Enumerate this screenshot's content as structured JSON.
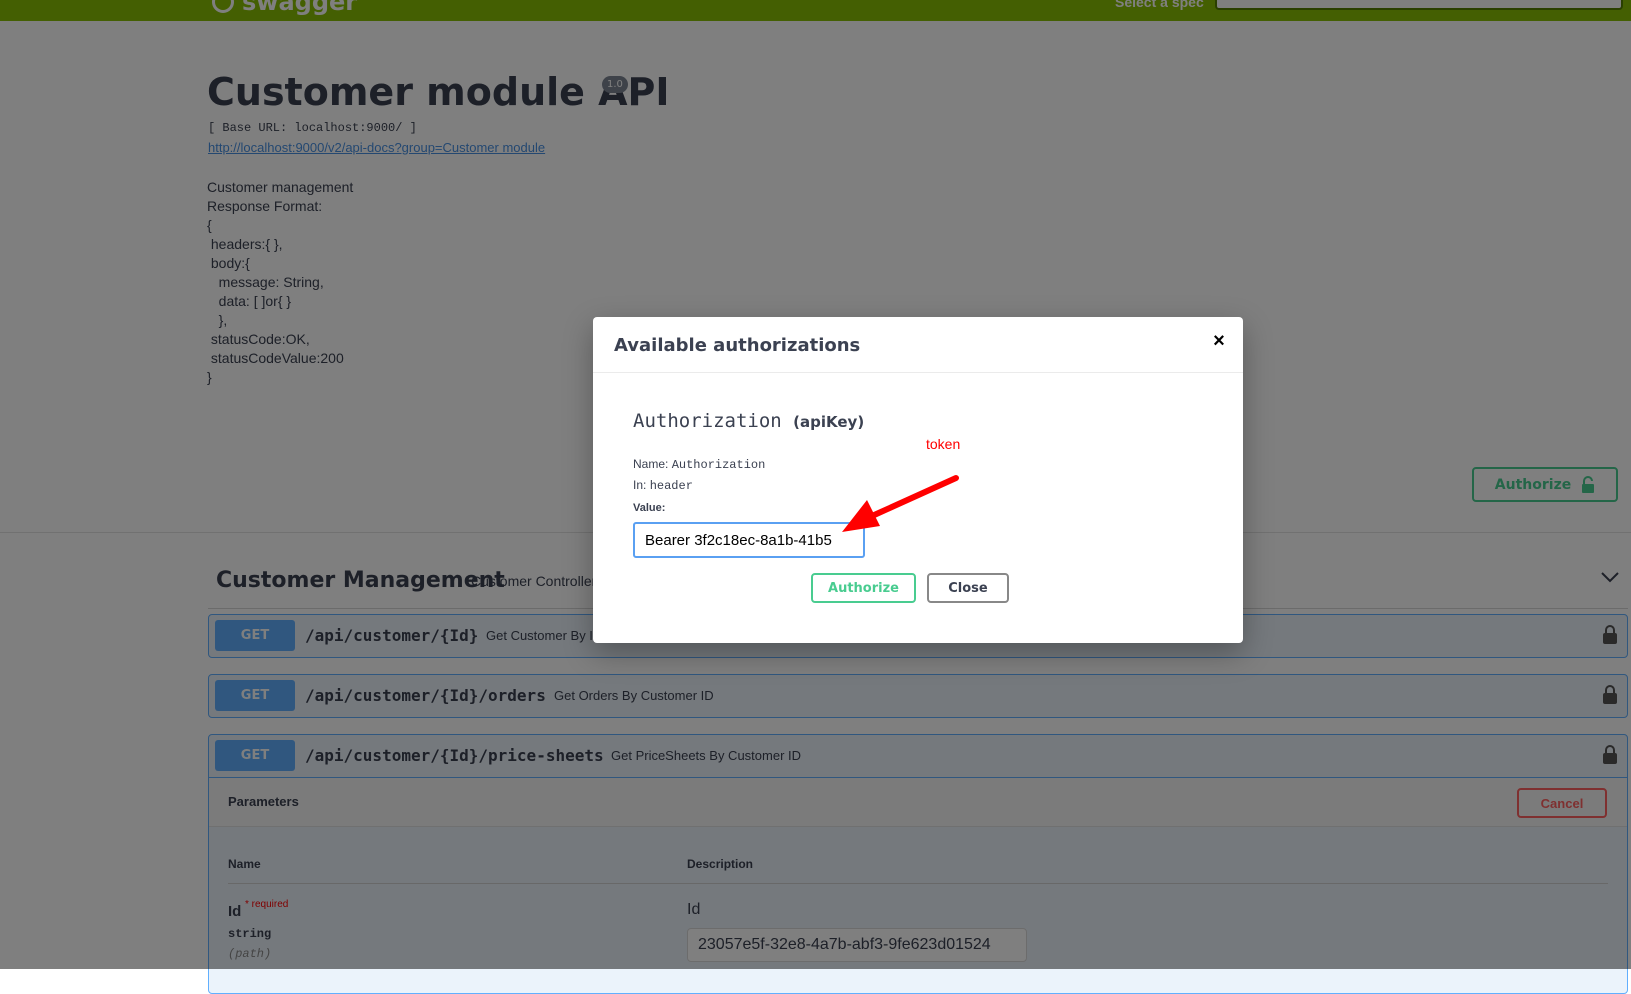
{
  "topbar": {
    "logo_text": "swagger",
    "spec_label": "Select a spec"
  },
  "info": {
    "title": "Customer module API",
    "version": "1.0",
    "base_url": "[ Base URL: localhost:9000/ ]",
    "spec_url": "http://localhost:9000/v2/api-docs?group=Customer module",
    "description": "Customer management\nResponse Format:\n{\n headers:{ },\n body:{\n   message: String,\n   data: [ ]or{ }\n   },\n statusCode:OK,\n statusCodeValue:200\n}"
  },
  "scheme": {
    "authorize_label": "Authorize"
  },
  "tag": {
    "title": "Customer Management",
    "description": "Customer Controller"
  },
  "operations": [
    {
      "method": "GET",
      "path": "/api/customer/{Id}",
      "summary": "Get Customer By ID"
    },
    {
      "method": "GET",
      "path": "/api/customer/{Id}/orders",
      "summary": "Get Orders By Customer ID"
    },
    {
      "method": "GET",
      "path": "/api/customer/{Id}/price-sheets",
      "summary": "Get PriceSheets By Customer ID"
    }
  ],
  "params": {
    "title": "Parameters",
    "cancel_label": "Cancel",
    "col_name": "Name",
    "col_description": "Description",
    "param_name": "Id",
    "required_label": "* required",
    "param_type": "string",
    "param_in": "(path)",
    "param_desc": "Id",
    "param_value": "23057e5f-32e8-4a7b-abf3-9fe623d01524"
  },
  "modal": {
    "title": "Available authorizations",
    "close_glyph": "×",
    "scheme_name": "Authorization",
    "scheme_type": "(apiKey)",
    "name_label": "Name:",
    "name_value": "Authorization",
    "in_label": "In:",
    "in_value": "header",
    "value_label": "Value:",
    "value_input": "Bearer 3f2c18ec-8a1b-41b5",
    "authorize_label": "Authorize",
    "close_label": "Close"
  },
  "annotation": {
    "note": "token",
    "color": "#ff0000"
  },
  "colors": {
    "topbar": "#89bf04",
    "get_method": "#61affe",
    "authorize": "#49cc90",
    "cancel": "#ff6060"
  }
}
